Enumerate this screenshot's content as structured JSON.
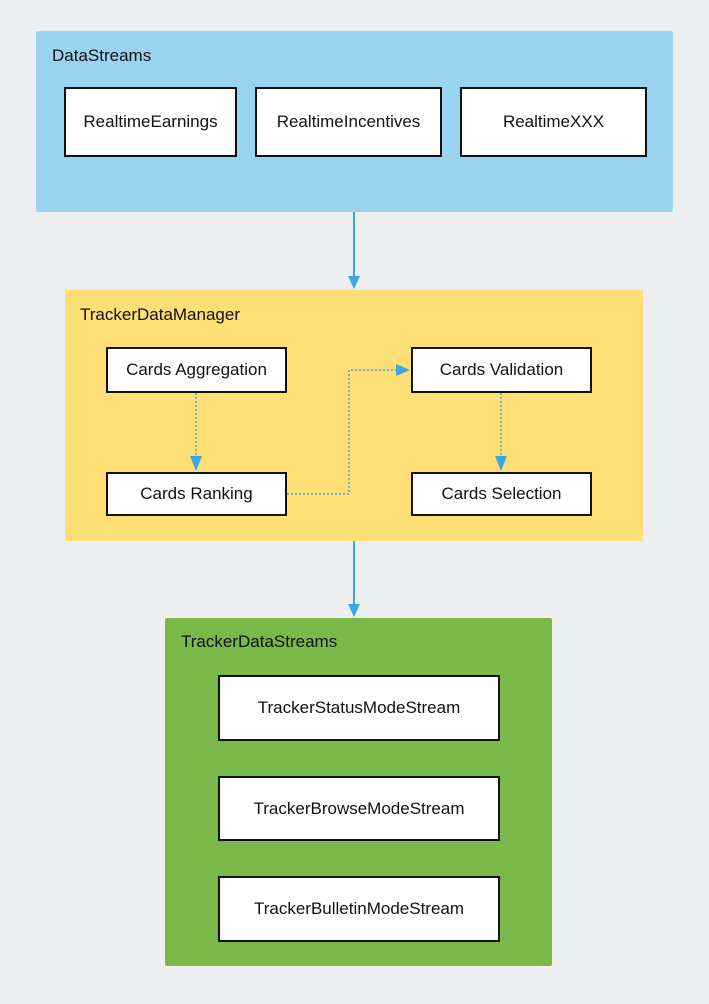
{
  "colors": {
    "background": "#edeef0",
    "datastreams": "#9ad3f0",
    "manager": "#fedf75",
    "tracker": "#7bb84a",
    "edge": "#3ba8e0"
  },
  "groups": {
    "datastreams": {
      "title": "DataStreams",
      "nodes": [
        "RealtimeEarnings",
        "RealtimeIncentives",
        "RealtimeXXX"
      ]
    },
    "manager": {
      "title": "TrackerDataManager",
      "nodes": {
        "aggregation": "Cards Aggregation",
        "ranking": "Cards Ranking",
        "validation": "Cards Validation",
        "selection": "Cards Selection"
      }
    },
    "tracker": {
      "title": "TrackerDataStreams",
      "nodes": [
        "TrackerStatusModeStream",
        "TrackerBrowseModeStream",
        "TrackerBulletinModeStream"
      ]
    }
  },
  "edges": [
    {
      "from": "DataStreams",
      "to": "TrackerDataManager",
      "style": "solid"
    },
    {
      "from": "TrackerDataManager",
      "to": "TrackerDataStreams",
      "style": "solid"
    },
    {
      "from": "Cards Aggregation",
      "to": "Cards Ranking",
      "style": "dotted"
    },
    {
      "from": "Cards Ranking",
      "to": "Cards Validation",
      "style": "dotted"
    },
    {
      "from": "Cards Validation",
      "to": "Cards Selection",
      "style": "dotted"
    }
  ]
}
